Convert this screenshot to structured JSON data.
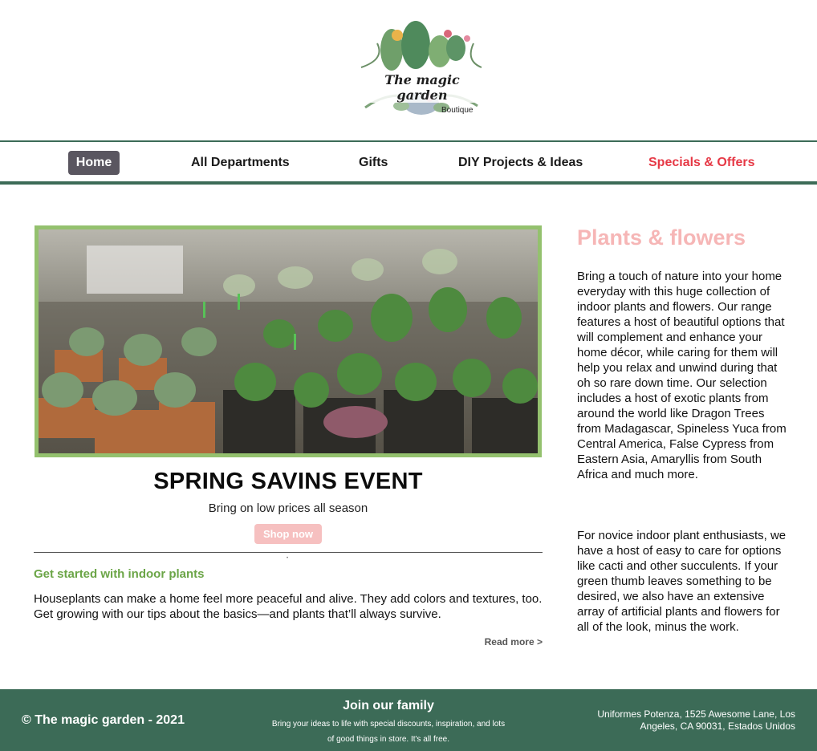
{
  "logo": {
    "name": "The magic garden",
    "subtitle": "Boutique"
  },
  "nav": {
    "items": [
      {
        "label": "Home",
        "active": true
      },
      {
        "label": "All Departments"
      },
      {
        "label": "Gifts"
      },
      {
        "label": "DIY Projects & Ideas"
      },
      {
        "label": "Specials & Offers",
        "highlight_color": "#e63946"
      }
    ]
  },
  "hero": {
    "image": "cactus-nursery-photo",
    "title": "SPRING SAVINS EVENT",
    "subtitle": "Bring on low prices all season",
    "button": "Shop now"
  },
  "article": {
    "title": "Get started with indoor plants",
    "body": "Houseplants can make a home feel more peaceful and alive. They add colors and textures, too. Get growing with our tips about the basics—and plants that’ll always survive.",
    "read_more": "Read more >"
  },
  "side": {
    "title": "Plants & flowers",
    "paragraph1": "Bring a touch of nature into your home everyday with this huge collection of indoor plants and flowers. Our range features a host of beautiful options that will complement and enhance your home décor, while caring for them will help you relax and unwind during that oh so rare down time. Our selection includes a host of exotic plants from around the world like Dragon Trees from Madagascar, Spineless Yuca from Central America, False Cypress from Eastern Asia, Amaryllis from South Africa and much more.",
    "paragraph2": "For novice indoor plant enthusiasts, we have a host of easy to care for options like cacti and other succulents. If your green thumb leaves something to be desired, we also have an extensive array of artificial plants and flowers for all of the look, minus the work."
  },
  "footer": {
    "copyright": "© The magic garden - 2021",
    "join_title": "Join our family",
    "join_text": "Bring your ideas to life with special discounts, inspiration, and lots of good things in store. It's all free.",
    "address": "Uniformes Potenza, 1525 Awesome Lane, Los Angeles, CA 90031, Estados Unidos"
  },
  "colors": {
    "brand_green": "#3c6b57",
    "accent_green": "#6ba547",
    "hero_border": "#94c16e",
    "pink": "#f6b6b6",
    "red": "#e63946"
  }
}
